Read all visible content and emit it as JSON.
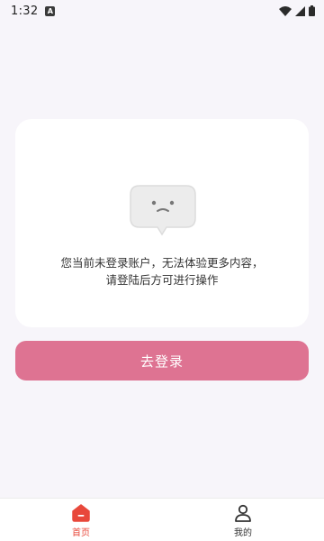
{
  "status_bar": {
    "time": "1:32",
    "notification_letter": "A"
  },
  "empty_state": {
    "line1": "您当前未登录账户，无法体验更多内容，",
    "line2": "请登陆后方可进行操作"
  },
  "login_button": {
    "label": "去登录"
  },
  "bottom_nav": {
    "items": [
      {
        "label": "首页",
        "icon": "home-icon",
        "active": true
      },
      {
        "label": "我的",
        "icon": "profile-icon",
        "active": false
      }
    ]
  },
  "colors": {
    "accent": "#de7392",
    "nav_active": "#e8483b",
    "background": "#f7f5fa"
  }
}
